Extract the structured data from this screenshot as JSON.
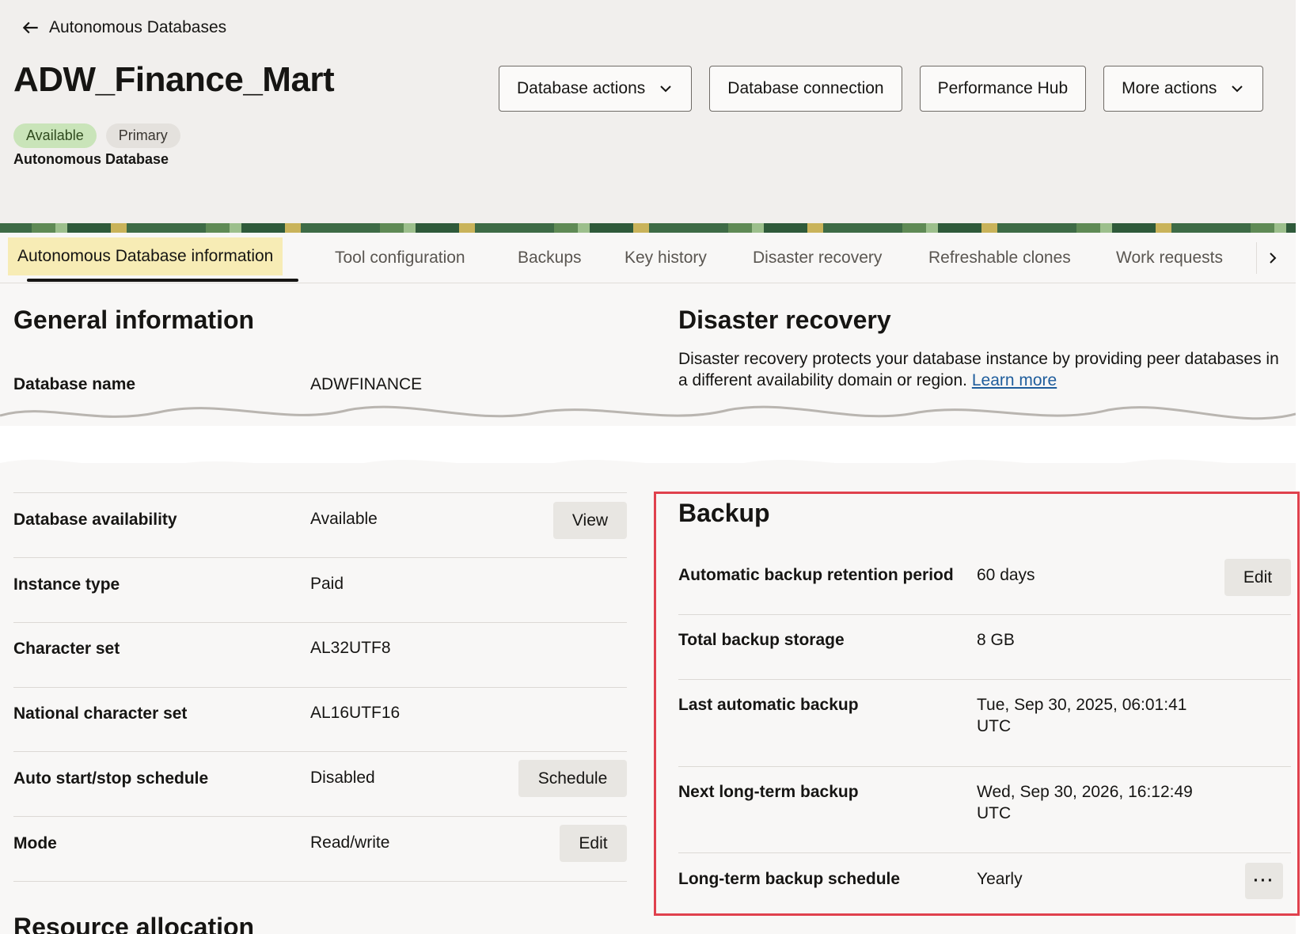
{
  "breadcrumb": {
    "back_label": "Autonomous Databases"
  },
  "header": {
    "title": "ADW_Finance_Mart",
    "badges": {
      "status": "Available",
      "role": "Primary"
    },
    "resource_type": "Autonomous Database",
    "actions": {
      "database_actions": "Database actions",
      "database_connection": "Database connection",
      "performance_hub": "Performance Hub",
      "more_actions": "More actions"
    }
  },
  "tabs": [
    {
      "label": "Autonomous Database information",
      "active": true
    },
    {
      "label": "Tool configuration"
    },
    {
      "label": "Backups"
    },
    {
      "label": "Key history"
    },
    {
      "label": "Disaster recovery"
    },
    {
      "label": "Refreshable clones"
    },
    {
      "label": "Work requests"
    }
  ],
  "general": {
    "title": "General information",
    "rows": {
      "db_name": {
        "label": "Database name",
        "value": "ADWFINANCE"
      },
      "availability": {
        "label": "Database availability",
        "value": "Available",
        "button": "View"
      },
      "instance_type": {
        "label": "Instance type",
        "value": "Paid"
      },
      "charset": {
        "label": "Character set",
        "value": "AL32UTF8"
      },
      "ncharset": {
        "label": "National character set",
        "value": "AL16UTF16"
      },
      "autostart": {
        "label": "Auto start/stop schedule",
        "value": "Disabled",
        "button": "Schedule"
      },
      "mode": {
        "label": "Mode",
        "value": "Read/write",
        "button": "Edit"
      }
    }
  },
  "resource_allocation": {
    "title": "Resource allocation"
  },
  "disaster_recovery": {
    "title": "Disaster recovery",
    "description": "Disaster recovery protects your database instance by providing peer databases in a different availability domain or region.",
    "learn_more": "Learn more"
  },
  "backup": {
    "title": "Backup",
    "rows": {
      "retention": {
        "label": "Automatic backup retention period",
        "value": "60 days",
        "button": "Edit"
      },
      "storage": {
        "label": "Total backup storage",
        "value": "8 GB"
      },
      "last_auto": {
        "label": "Last automatic backup",
        "value_line1": "Tue, Sep 30, 2025, 06:01:41",
        "value_line2": "UTC"
      },
      "next_long_term": {
        "label": "Next long-term backup",
        "value_line1": "Wed, Sep 30, 2026, 16:12:49",
        "value_line2": "UTC"
      },
      "schedule": {
        "label": "Long-term backup schedule",
        "value": "Yearly",
        "button": "···"
      }
    }
  }
}
